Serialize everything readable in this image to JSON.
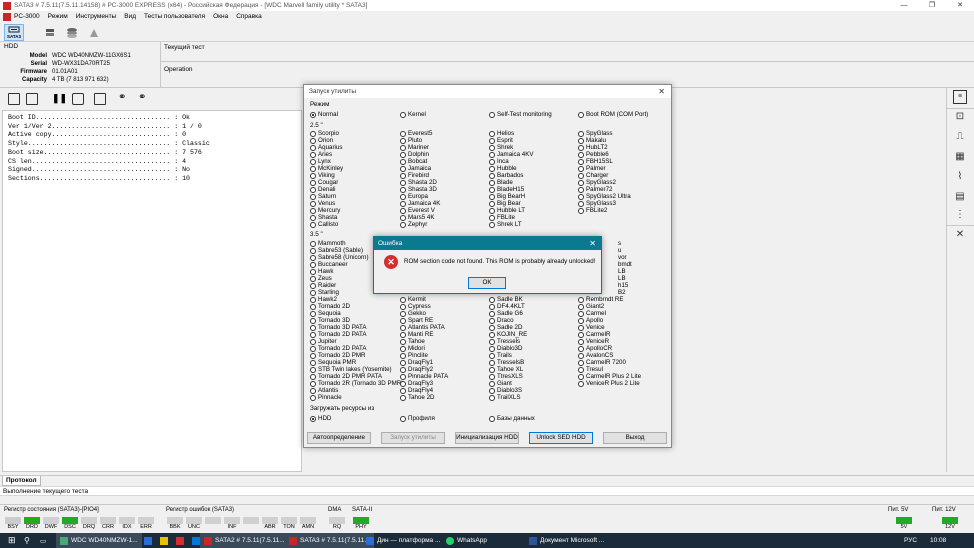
{
  "window": {
    "title": "SATA3 # 7.5.11(7.5.11.14158) # PC-3000 EXPRESS (x64) - Российская Федерация - [WDC Marvell family utility * SATA3]",
    "controls": [
      "—",
      "❐",
      "✕"
    ]
  },
  "menu": [
    "PC-3000",
    "Режим",
    "Инструменты",
    "Вид",
    "Тесты пользователя",
    "Окна",
    "Справка"
  ],
  "toolbar": {
    "sata_label": "SATA3"
  },
  "hdd": {
    "heading": "HDD",
    "rows": [
      {
        "label": "Model",
        "value": "WDC WD40NMZW-11GX6S1"
      },
      {
        "label": "Serial",
        "value": "WD-WX31DA70RT25"
      },
      {
        "label": "Firmware",
        "value": "01.01A01"
      },
      {
        "label": "Capacity",
        "value": "4 TB (7 813 971 632)"
      }
    ]
  },
  "current_test": {
    "label": "Текущий тест",
    "operation": "Operation"
  },
  "log_lines": [
    "Boot ID.................................. : Ok",
    "Ver 1/Ver 2.............................. : 1 / 0",
    "Active copy.............................. : 0",
    "Style.................................... : Classic",
    "Boot size................................ : 7 576",
    "CS len................................... : 4",
    "Signed................................... : No",
    "Sections................................. : 10"
  ],
  "dialog": {
    "title": "Запуск утилиты",
    "mode_label": "Режим",
    "modes": [
      {
        "label": "Normal",
        "selected": true
      },
      {
        "label": "Kernel",
        "selected": false
      },
      {
        "label": "Self-Test monitoring",
        "selected": false
      },
      {
        "label": "Boot ROM (COM Port)",
        "selected": false
      }
    ],
    "group_25": "2.5 \"",
    "col25": [
      [
        "Scorpio",
        "Orion",
        "Aquarius",
        "Aries",
        "Lynx",
        "McKinley",
        "Viking",
        "Cougar",
        "Denali",
        "Saturn",
        "Venus",
        "Mercury",
        "Shasta",
        "Callisto"
      ],
      [
        "Everest5",
        "Pluto",
        "Mariner",
        "Dolphin",
        "Bobcat",
        "Jamaica",
        "Firebird",
        "Shasta 2D",
        "Shasta 3D",
        "Europa",
        "Jamaica 4K",
        "Everest V",
        "Mars5 4K",
        "Zephyr"
      ],
      [
        "Helios",
        "Esprit",
        "Shrek",
        "Jamaica 4KV",
        "Inca",
        "Hubble",
        "Barbados",
        "Blade",
        "BladeH15",
        "Big BearH",
        "Big Bear",
        "Hubble LT",
        "FBLite",
        "Shrek LT"
      ],
      [
        "SpyGlass",
        "Makalu",
        "HubLT2",
        "Pebble6",
        "FBH15SL",
        "Palmer",
        "Charger",
        "SpyGlass2",
        "Palmer72",
        "SpyGlass2 Ultra",
        "SpyGlass3",
        "FBLite2"
      ]
    ],
    "group_35": "3.5 \"",
    "col35": [
      [
        "Mammoth",
        "Sabre53 (Sable)",
        "Sabre58 (Unicorn)",
        "Buccaneer",
        "Hawk",
        "Zeus",
        "Raider",
        "Starling",
        "Hawk2",
        "Tornado 2D",
        "Sequoia",
        "Tornado 3D",
        "Tornado 3D PATA",
        "Tornado 2D PATA",
        "Jupiter",
        "Tornado 2D PATA",
        "Tornado 2D PMR",
        "Sequoia PMR",
        "STB Twin lakes (Yosemite)",
        "Tornado 2D PMR PATA",
        "Tornado 2R (Tornado 3D PMR)",
        "Atlantis",
        "Pinnacle"
      ],
      [
        "Kermit",
        "Cypress",
        "Gekko",
        "Spart RE",
        "Atlantis PATA",
        "Manti RE",
        "Tahoe",
        "Midori",
        "Pinclite",
        "DraqFly1",
        "DraqFly2",
        "Pinnacle PATA",
        "DraqFly3",
        "DraqFly4",
        "Tahoe 2D"
      ],
      [
        "Sadle BK",
        "DF4.4KLT",
        "Sadle G6",
        "Draco",
        "Sadle 2D",
        "KOJIN_RE",
        "Tressels",
        "Diablo3D",
        "Trails",
        "TresselsB",
        "Tahoe XL",
        "TtresXLS",
        "Giant",
        "Diablo3S",
        "TrailXLS"
      ],
      [
        "Rembrndt RE",
        "Giant2",
        "Carmel",
        "Apollo",
        "Venice",
        "CarmelR",
        "VeniceR",
        "ApolloCR",
        "AvalonCS",
        "CarmelR 7200",
        "Tresul",
        "CarmelR Plus 2 Lite",
        "VeniceR Plus 2 Lite"
      ],
      [
        "s",
        "u",
        "vor",
        "bmdt",
        "LB",
        "LB",
        "h15",
        "B2"
      ]
    ],
    "load_label": "Загружать ресурсы из",
    "load_opts": [
      {
        "label": "HDD",
        "selected": true
      },
      {
        "label": "Профиля",
        "selected": false
      },
      {
        "label": "Базы данных",
        "selected": false
      }
    ],
    "buttons": [
      "Автоопределение",
      "Запуск утилиты",
      "Инициализация HDD",
      "Unlock SED HDD",
      "Выход"
    ]
  },
  "error": {
    "title": "Ошибка",
    "message": "ROM section code not found. This ROM is probably already unlocked!",
    "ok": "OK"
  },
  "bottom": {
    "tab": "Протокол",
    "exec": "Выполнение текущего теста",
    "reg_status": "Регистр состояния (SATA3)-[PIO4]",
    "reg_status_bits": [
      "BSY",
      "DRD",
      "DWF",
      "DSC",
      "DRQ",
      "CRR",
      "IDX",
      "ERR"
    ],
    "reg_err": "Регистр ошибок (SATA3)",
    "reg_err_bits": [
      "BBK",
      "UNC",
      "",
      "INF",
      "",
      "ABR",
      "TON",
      "AMN"
    ],
    "dma": "DMA",
    "dma_bit": "RQ",
    "sata": "SATA-II",
    "sata_bit": "PHY",
    "pit5": "Пит. 5V",
    "pit5_val": "5V",
    "pit12": "Пит. 12V",
    "pit12_val": "12V"
  },
  "taskbar": {
    "items": [
      "WDC WD40NMZW-1...",
      "SATA2 # 7.5.11(7.5.11...",
      "SATA3 # 7.5.11(7.5.11...",
      "Дин — платформа ...",
      "WhatsApp",
      "Документ Microsoft ..."
    ],
    "lang": "РУС",
    "time": "10:08"
  },
  "colors": {
    "accent": "#0078d7",
    "error_title": "#0b7a8f",
    "brand": "#c62828",
    "taskbar": "#1c2b3a",
    "status_green": "#22aa22",
    "status_red": "#d32f2f"
  }
}
